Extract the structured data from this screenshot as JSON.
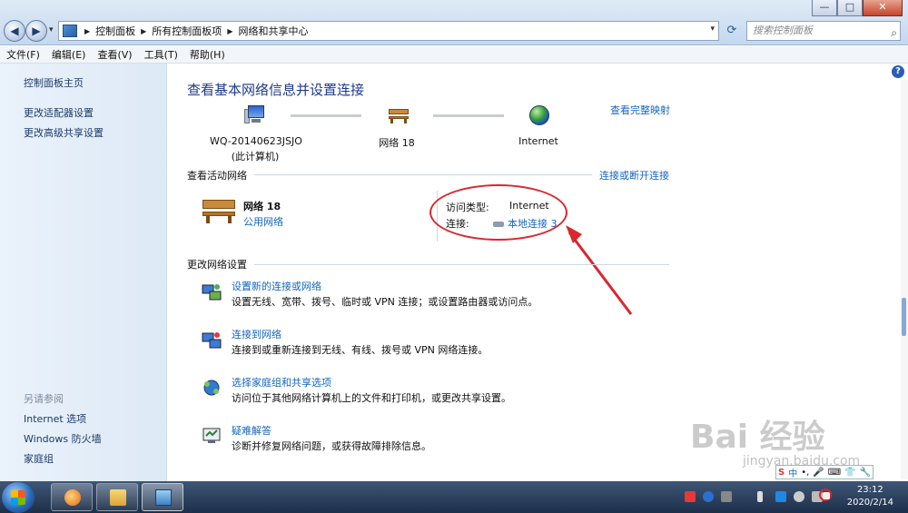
{
  "window": {
    "buttons": {
      "minimize": "—",
      "maximize": "□",
      "close": "✕"
    },
    "nav": {
      "back": "◀",
      "forward": "▶",
      "history": "▾"
    },
    "breadcrumbs": [
      "控制面板",
      "所有控制面板项",
      "网络和共享中心"
    ],
    "breadcrumb_sep": "▶",
    "search_placeholder": "搜索控制面板"
  },
  "menubar": [
    "文件(F)",
    "编辑(E)",
    "查看(V)",
    "工具(T)",
    "帮助(H)"
  ],
  "sidebar": {
    "links": [
      "控制面板主页",
      "更改适配器设置",
      "更改高级共享设置"
    ],
    "see_also_heading": "另请参阅",
    "see_also": [
      "Internet 选项",
      "Windows 防火墙",
      "家庭组"
    ]
  },
  "main": {
    "help": "?",
    "title": "查看基本网络信息并设置连接",
    "full_map_link": "查看完整映射",
    "map": {
      "computer_name": "WQ-20140623JSJO",
      "computer_sub": "(此计算机)",
      "network": "网络 18",
      "internet": "Internet"
    },
    "active_heading": "查看活动网络",
    "connect_link": "连接或断开连接",
    "active": {
      "name": "网络  18",
      "type": "公用网络",
      "access_label": "访问类型:",
      "access_value": "Internet",
      "connection_label": "连接:",
      "connection_value": "本地连接 3"
    },
    "change_heading": "更改网络设置",
    "tasks": [
      {
        "title": "设置新的连接或网络",
        "desc": "设置无线、宽带、拨号、临时或 VPN 连接；或设置路由器或访问点。"
      },
      {
        "title": "连接到网络",
        "desc": "连接到或重新连接到无线、有线、拨号或 VPN 网络连接。"
      },
      {
        "title": "选择家庭组和共享选项",
        "desc": "访问位于其他网络计算机上的文件和打印机，或更改共享设置。"
      },
      {
        "title": "疑难解答",
        "desc": "诊断并修复网络问题，或获得故障排除信息。"
      }
    ]
  },
  "tray": {
    "time": "23:12",
    "date": "2020/2/14",
    "ime": [
      "S",
      "中",
      "•,",
      "🎤",
      "⌨",
      "👕",
      "🔧"
    ]
  },
  "watermark": {
    "main": "Bai 经验",
    "sub": "jingyan.baidu.com"
  },
  "colors": {
    "link": "#1566c0",
    "title": "#1e3a8a",
    "annotation": "#d9272e"
  }
}
